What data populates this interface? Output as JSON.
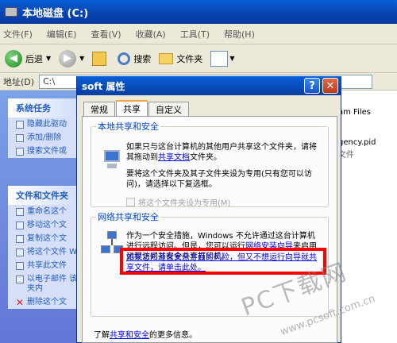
{
  "window": {
    "title": "本地磁盘 (C:)"
  },
  "menu": [
    "文件(F)",
    "编辑(E)",
    "查看(V)",
    "收藏(A)",
    "工具(T)",
    "帮助(H)"
  ],
  "toolbar": {
    "back_label": "后退",
    "search_label": "搜索",
    "folders_label": "文件夹"
  },
  "address": {
    "label": "地址(D)",
    "value": "C:\\"
  },
  "sidebar": {
    "system_tasks": {
      "title": "系统任务",
      "items": [
        "隐藏此驱动",
        "添加/删除",
        "搜索文件或"
      ]
    },
    "file_tasks": {
      "title": "文件和文件夹",
      "items": [
        "重命名这个",
        "移动这个文",
        "复制这个文",
        "将这个文件 Web",
        "共享此文件",
        "以电子邮件 该文件夹内",
        "删除这个文"
      ]
    }
  },
  "right_pane": {
    "item1": "am Files",
    "item2": "gency.pid",
    "item3": "文件"
  },
  "dialog": {
    "title": "soft 属性",
    "tabs": [
      "常规",
      "共享",
      "自定义"
    ],
    "local": {
      "legend": "本地共享和安全",
      "p1_a": "如果只与这台计算机的其他用户共享这个文件夹，请将其拖动到",
      "p1_link": "共享文档",
      "p1_b": "文件夹。",
      "p2": "要将这个文件夹及其子文件夹设为专用(只有您可以访问)，请选择以下复选框。",
      "checkbox": "将这个文件夹设为专用(M)"
    },
    "network": {
      "legend": "网络共享和安全",
      "p1": "作为一个安全措施，Windows 不允许通过这台计算机进行远程访问。但是，您可以运行",
      "wizard_link": "网络安装向导",
      "p1_b": "来启用远程访问并安全共享打印机。",
      "risk_link": "如果您知道在安全方面的风险，但又不想运行向导就共享文件，请单击此处。"
    },
    "learn": {
      "prefix": "了解",
      "link": "共享和安全",
      "suffix": "的更多信息。"
    }
  },
  "watermark": {
    "main": "PC下载网",
    "url": "www.pcsoft.com.cn"
  }
}
